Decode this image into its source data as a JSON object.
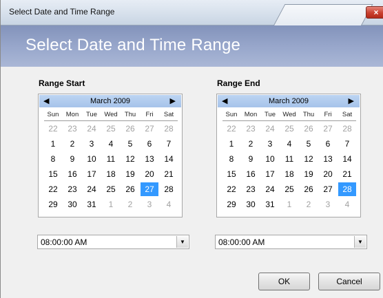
{
  "window": {
    "title": "Select Date and Time Range",
    "close_label": "×"
  },
  "header": {
    "title": "Select Date and Time Range"
  },
  "start": {
    "label": "Range Start",
    "month": "March 2009",
    "time": "08:00:00 AM",
    "selected_day": 27,
    "days": [
      [
        22,
        23,
        24,
        25,
        26,
        27,
        28
      ],
      [
        1,
        2,
        3,
        4,
        5,
        6,
        7
      ],
      [
        8,
        9,
        10,
        11,
        12,
        13,
        14
      ],
      [
        15,
        16,
        17,
        18,
        19,
        20,
        21
      ],
      [
        22,
        23,
        24,
        25,
        26,
        27,
        28
      ],
      [
        29,
        30,
        31,
        1,
        2,
        3,
        4
      ]
    ]
  },
  "end": {
    "label": "Range End",
    "month": "March 2009",
    "time": "08:00:00 AM",
    "selected_day": 28,
    "days": [
      [
        22,
        23,
        24,
        25,
        26,
        27,
        28
      ],
      [
        1,
        2,
        3,
        4,
        5,
        6,
        7
      ],
      [
        8,
        9,
        10,
        11,
        12,
        13,
        14
      ],
      [
        15,
        16,
        17,
        18,
        19,
        20,
        21
      ],
      [
        22,
        23,
        24,
        25,
        26,
        27,
        28
      ],
      [
        29,
        30,
        31,
        1,
        2,
        3,
        4
      ]
    ]
  },
  "weekdays": [
    "Sun",
    "Mon",
    "Tue",
    "Wed",
    "Thu",
    "Fri",
    "Sat"
  ],
  "arrows": {
    "prev": "◀",
    "next": "▶",
    "dropdown": "▼"
  },
  "buttons": {
    "ok": "OK",
    "cancel": "Cancel"
  },
  "colors": {
    "header": "#99a8cc",
    "month_bar": "#b3cdef",
    "selection": "#3399ff",
    "other_month_text": "#a2a2a2"
  }
}
